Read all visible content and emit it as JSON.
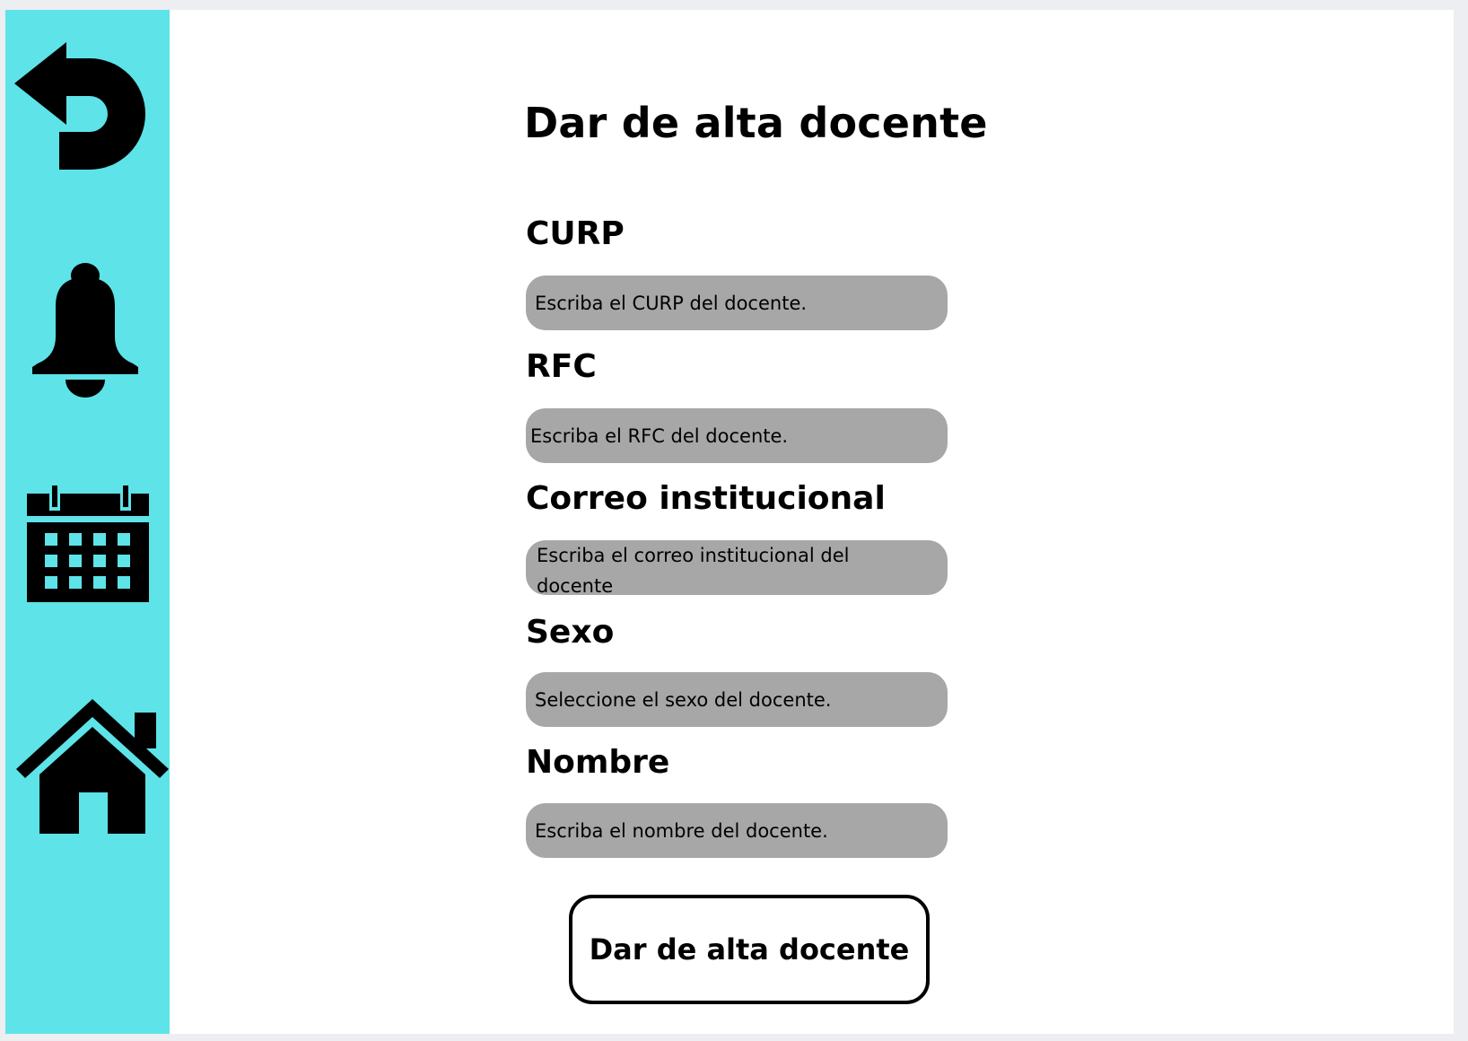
{
  "page": {
    "title": "Dar de alta docente"
  },
  "sidebar": {
    "items": [
      {
        "icon": "back-arrow-icon"
      },
      {
        "icon": "bell-icon"
      },
      {
        "icon": "calendar-icon"
      },
      {
        "icon": "home-icon"
      }
    ],
    "color": "#5de3e8"
  },
  "form": {
    "fields": [
      {
        "label": "CURP",
        "placeholder": "Escriba el CURP del docente."
      },
      {
        "label": "RFC",
        "placeholder": "Escriba el RFC del docente."
      },
      {
        "label": "Correo institucional",
        "placeholder": "Escriba el correo institucional del docente"
      },
      {
        "label": "Sexo",
        "placeholder": "Seleccione el sexo del docente."
      },
      {
        "label": "Nombre",
        "placeholder": "Escriba el nombre del docente."
      }
    ],
    "input_color": "#a7a7a7",
    "submit_label": "Dar de alta docente"
  }
}
